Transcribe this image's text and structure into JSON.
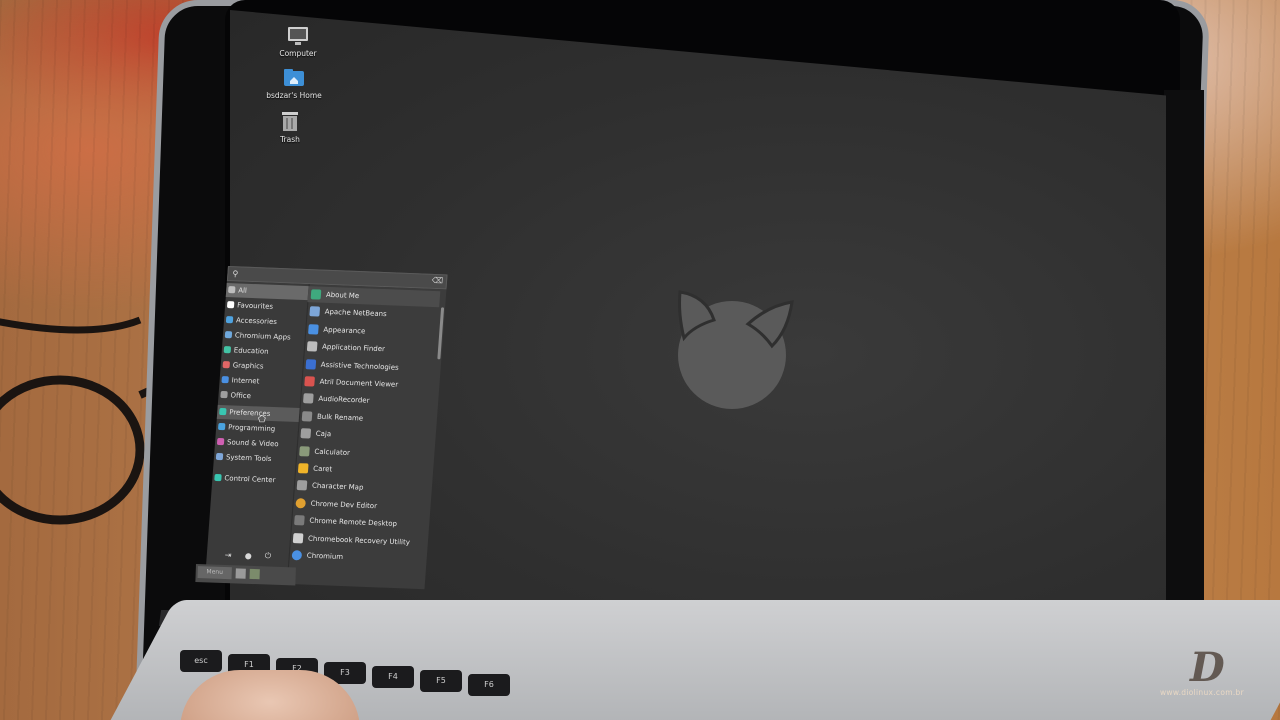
{
  "desktop": {
    "icons": [
      {
        "label": "Computer",
        "icon": "computer-icon"
      },
      {
        "label": "bsdzar's Home",
        "icon": "home-folder-icon"
      },
      {
        "label": "Trash",
        "icon": "trash-icon"
      }
    ]
  },
  "menu": {
    "search": {
      "placeholder": ""
    },
    "categories": [
      {
        "label": "All",
        "icon": "star-icon",
        "color": "#bdbdbd"
      },
      {
        "label": "Favourites",
        "icon": "heart-icon",
        "color": "#ffffff"
      },
      {
        "label": "Accessories",
        "icon": "accessories-icon",
        "color": "#4fa3e0"
      },
      {
        "label": "Chromium Apps",
        "icon": "chromium-apps-icon",
        "color": "#6fa8dc"
      },
      {
        "label": "Education",
        "icon": "education-icon",
        "color": "#43c3a5"
      },
      {
        "label": "Graphics",
        "icon": "graphics-icon",
        "color": "#e06666"
      },
      {
        "label": "Internet",
        "icon": "internet-icon",
        "color": "#4a90e2"
      },
      {
        "label": "Office",
        "icon": "office-icon",
        "color": "#9e9e9e"
      },
      {
        "label": "Preferences",
        "icon": "preferences-icon",
        "color": "#39c6b1"
      },
      {
        "label": "Programming",
        "icon": "programming-icon",
        "color": "#4aa3df"
      },
      {
        "label": "Sound & Video",
        "icon": "sound-video-icon",
        "color": "#d05fb2"
      },
      {
        "label": "System Tools",
        "icon": "system-tools-icon",
        "color": "#7fa7d9"
      },
      {
        "label": "Control Center",
        "icon": "control-center-icon",
        "color": "#39c6b1"
      }
    ],
    "selected_category": "Preferences",
    "apps": [
      {
        "label": "About Me",
        "icon": "user-icon",
        "color": "#3fa97e"
      },
      {
        "label": "Apache NetBeans",
        "icon": "netbeans-icon",
        "color": "#7da6d8"
      },
      {
        "label": "Appearance",
        "icon": "appearance-icon",
        "color": "#4a90e2"
      },
      {
        "label": "Application Finder",
        "icon": "search-icon",
        "color": "#bdbdbd"
      },
      {
        "label": "Assistive Technologies",
        "icon": "accessibility-icon",
        "color": "#3b6fd1"
      },
      {
        "label": "Atril Document Viewer",
        "icon": "pdf-icon",
        "color": "#d9534f"
      },
      {
        "label": "AudioRecorder",
        "icon": "microphone-icon",
        "color": "#9e9e9e"
      },
      {
        "label": "Bulk Rename",
        "icon": "rename-icon",
        "color": "#8a8a8a"
      },
      {
        "label": "Caja",
        "icon": "file-manager-icon",
        "color": "#9e9e9e"
      },
      {
        "label": "Calculator",
        "icon": "calculator-icon",
        "color": "#8a9a7a"
      },
      {
        "label": "Caret",
        "icon": "caret-icon",
        "color": "#f0b429"
      },
      {
        "label": "Character Map",
        "icon": "character-map-icon",
        "color": "#9e9e9e"
      },
      {
        "label": "Chrome Dev Editor",
        "icon": "chrome-icon",
        "color": "#e0a030"
      },
      {
        "label": "Chrome Remote Desktop",
        "icon": "remote-desktop-icon",
        "color": "#7a7a7a"
      },
      {
        "label": "Chromebook Recovery Utility",
        "icon": "recovery-icon",
        "color": "#d0d0d0"
      },
      {
        "label": "Chromium",
        "icon": "chromium-icon",
        "color": "#4a90e2"
      }
    ],
    "bottom_icons": [
      "logout-icon",
      "lock-icon",
      "power-icon"
    ]
  },
  "panel": {
    "menu_button": "Menu"
  },
  "watermark": {
    "mark": "D",
    "url": "www.diolinux.com.br"
  }
}
